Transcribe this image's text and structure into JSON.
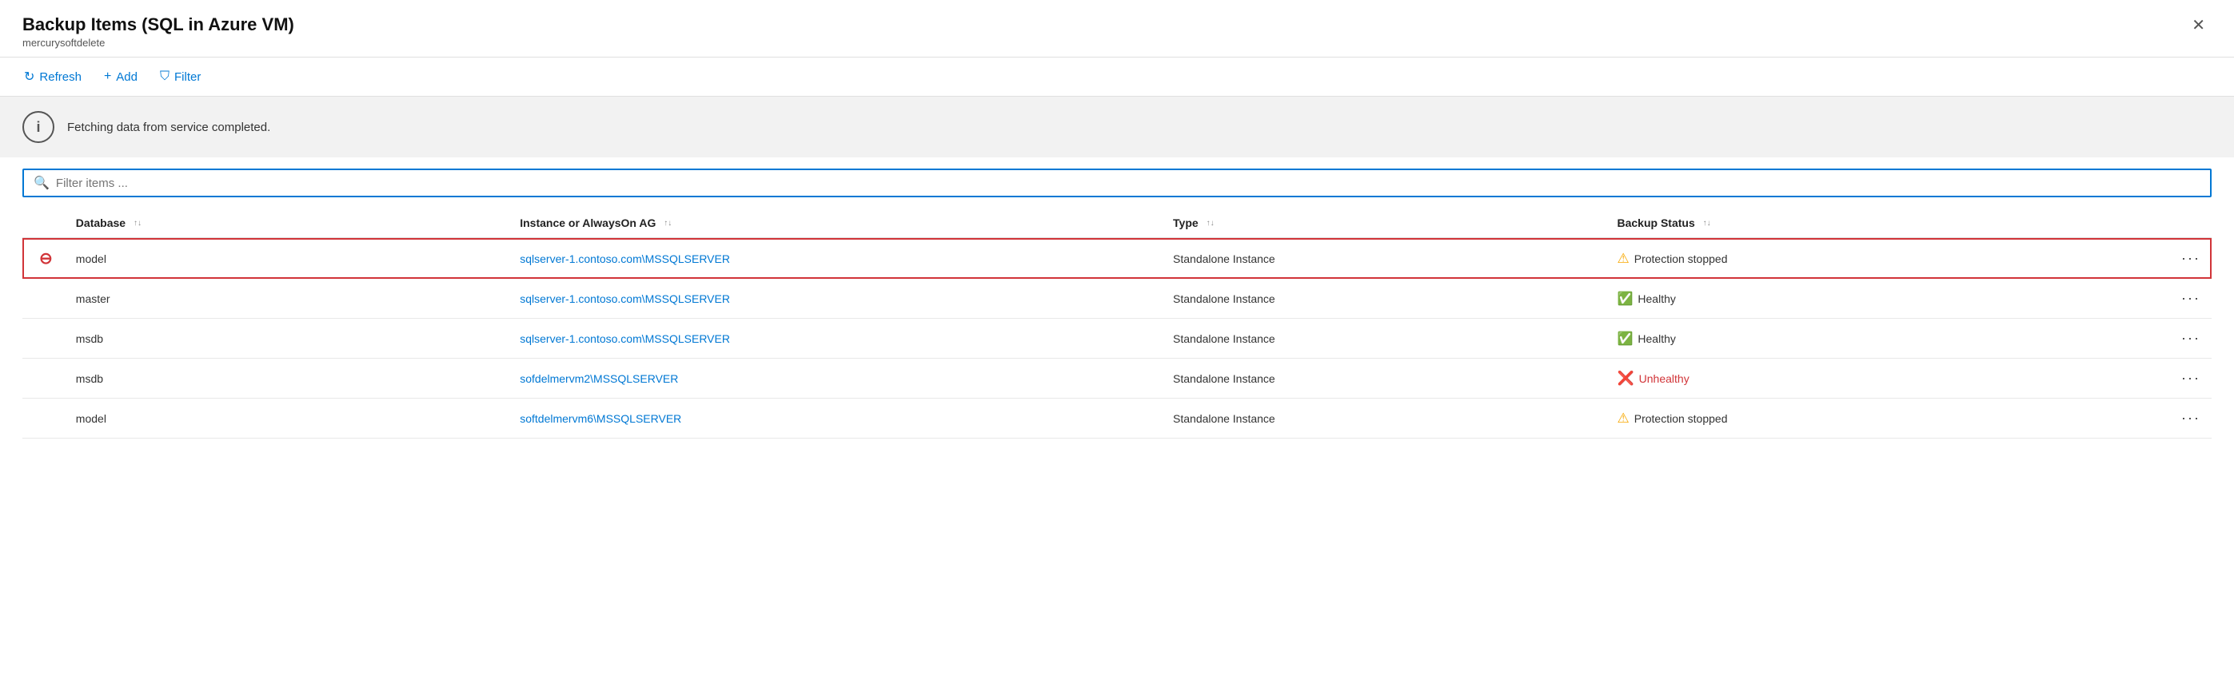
{
  "header": {
    "title": "Backup Items (SQL in Azure VM)",
    "subtitle": "mercurysoftdelete",
    "close_label": "✕"
  },
  "toolbar": {
    "refresh_label": "Refresh",
    "add_label": "Add",
    "filter_label": "Filter"
  },
  "banner": {
    "message": "Fetching data from service completed."
  },
  "search": {
    "placeholder": "Filter items ..."
  },
  "table": {
    "columns": [
      {
        "key": "db",
        "label": "Database",
        "sortable": true
      },
      {
        "key": "instance",
        "label": "Instance or AlwaysOn AG",
        "sortable": true
      },
      {
        "key": "type",
        "label": "Type",
        "sortable": true
      },
      {
        "key": "status",
        "label": "Backup Status",
        "sortable": true
      }
    ],
    "rows": [
      {
        "id": 1,
        "selected": true,
        "icon": "remove",
        "db": "model",
        "instance": "sqlserver-1.contoso.com\\MSSQLSERVER",
        "type": "Standalone Instance",
        "status_icon": "warning",
        "status_text": "Protection stopped",
        "status_class": "protection-stopped"
      },
      {
        "id": 2,
        "selected": false,
        "icon": null,
        "db": "master",
        "instance": "sqlserver-1.contoso.com\\MSSQLSERVER",
        "type": "Standalone Instance",
        "status_icon": "success",
        "status_text": "Healthy",
        "status_class": "healthy"
      },
      {
        "id": 3,
        "selected": false,
        "icon": null,
        "db": "msdb",
        "instance": "sqlserver-1.contoso.com\\MSSQLSERVER",
        "type": "Standalone Instance",
        "status_icon": "success",
        "status_text": "Healthy",
        "status_class": "healthy"
      },
      {
        "id": 4,
        "selected": false,
        "icon": null,
        "db": "msdb",
        "instance": "sofdelmervm2\\MSSQLSERVER",
        "type": "Standalone Instance",
        "status_icon": "error",
        "status_text": "Unhealthy",
        "status_class": "unhealthy"
      },
      {
        "id": 5,
        "selected": false,
        "icon": null,
        "db": "model",
        "instance": "softdelmervm6\\MSSQLSERVER",
        "type": "Standalone Instance",
        "status_icon": "warning",
        "status_text": "Protection stopped",
        "status_class": "protection-stopped"
      }
    ]
  }
}
